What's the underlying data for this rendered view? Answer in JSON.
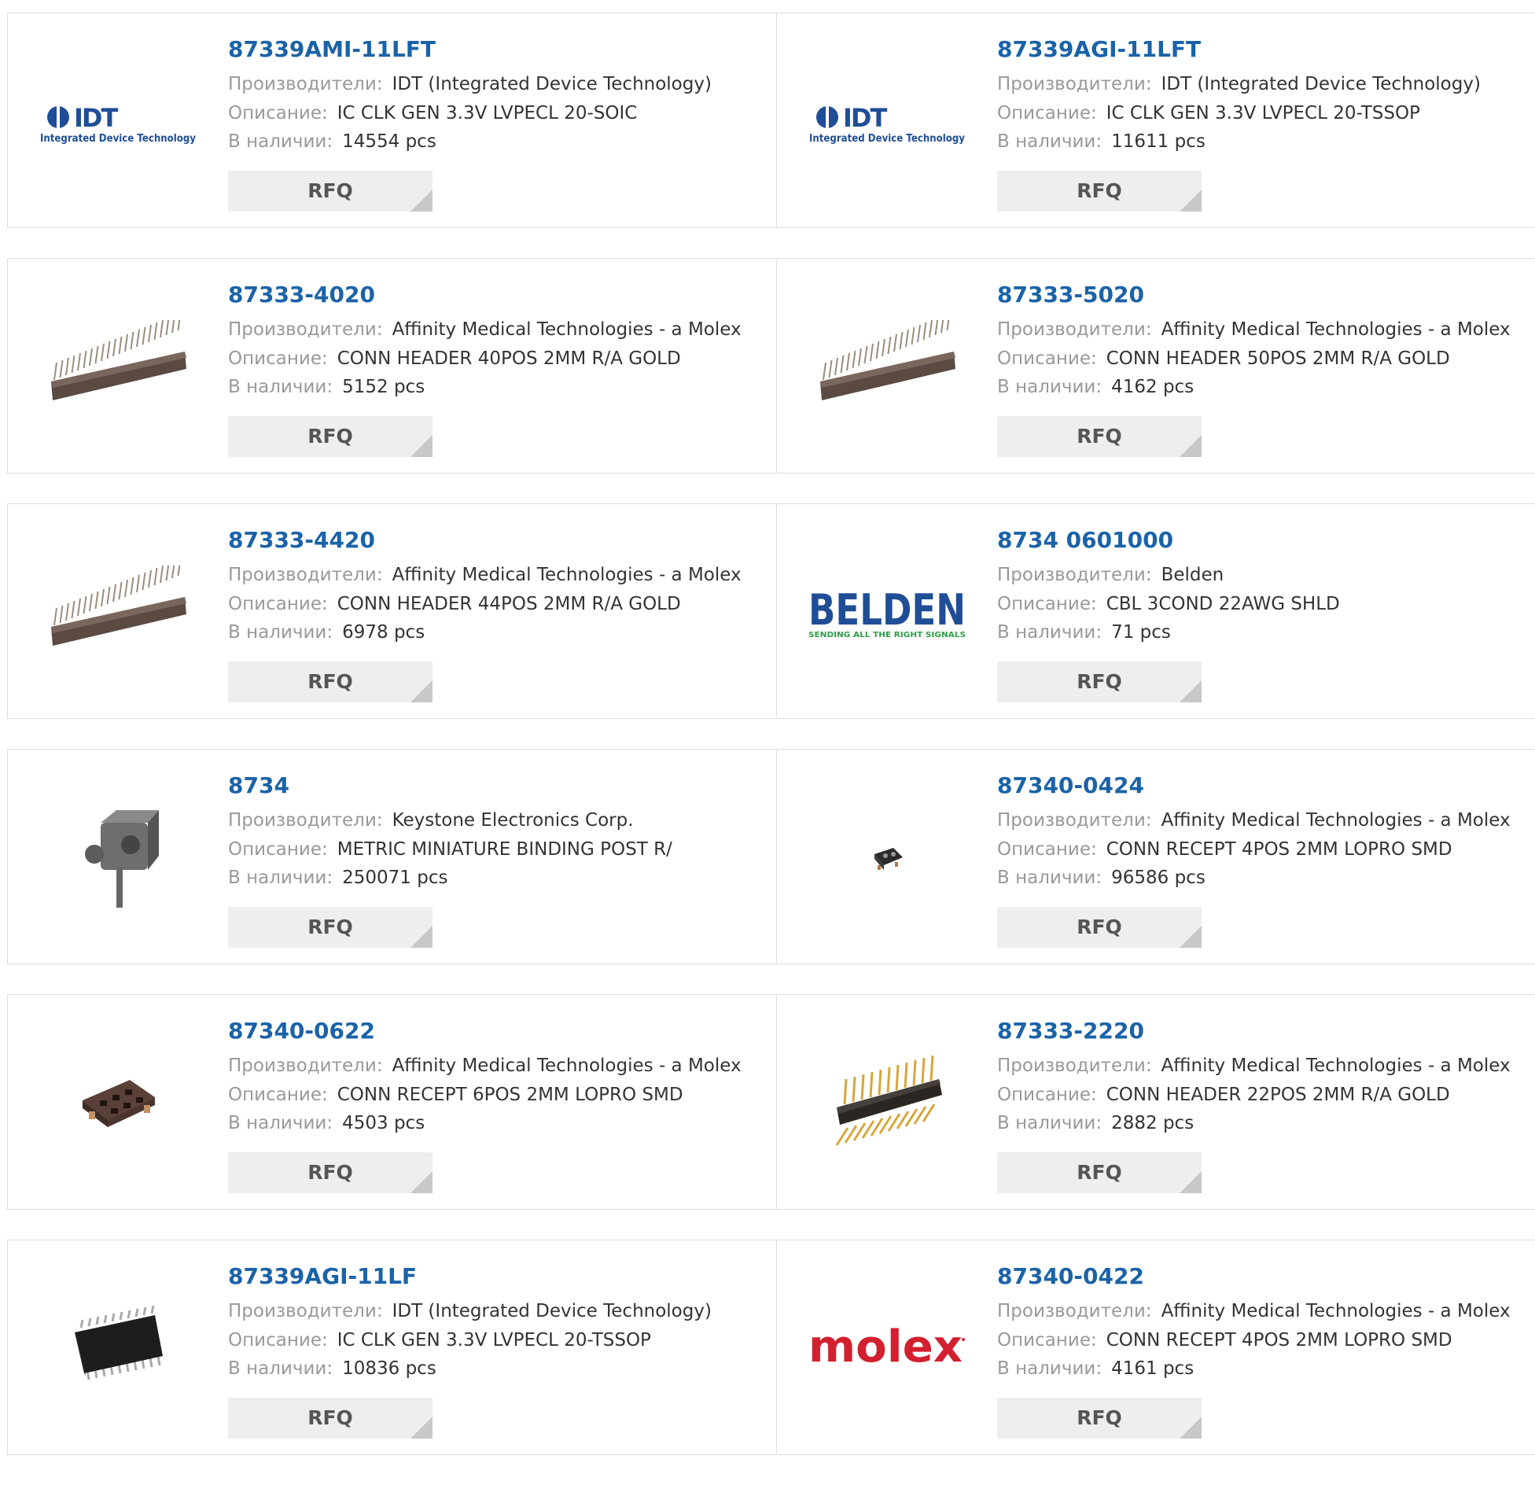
{
  "labels": {
    "manufacturer": "Производители:",
    "description": "Описание:",
    "stock": "В наличии:",
    "rfq": "RFQ"
  },
  "products": [
    {
      "pn": "87339AMI-11LFT",
      "manufacturer": "IDT (Integrated Device Technology)",
      "description": "IC CLK GEN 3.3V LVPECL 20-SOIC",
      "stock": "14554 pcs",
      "image": "idt-logo"
    },
    {
      "pn": "87339AGI-11LFT",
      "manufacturer": "IDT (Integrated Device Technology)",
      "description": "IC CLK GEN 3.3V LVPECL 20-TSSOP",
      "stock": "11611 pcs",
      "image": "idt-logo"
    },
    {
      "pn": "87333-4020",
      "manufacturer": "Affinity Medical Technologies - a Molex",
      "description": "CONN HEADER 40POS 2MM R/A GOLD",
      "stock": "5152 pcs",
      "image": "header-connector"
    },
    {
      "pn": "87333-5020",
      "manufacturer": "Affinity Medical Technologies - a Molex",
      "description": "CONN HEADER 50POS 2MM R/A GOLD",
      "stock": "4162 pcs",
      "image": "header-connector"
    },
    {
      "pn": "87333-4420",
      "manufacturer": "Affinity Medical Technologies - a Molex",
      "description": "CONN HEADER 44POS 2MM R/A GOLD",
      "stock": "6978 pcs",
      "image": "header-connector"
    },
    {
      "pn": "8734 0601000",
      "manufacturer": "Belden",
      "description": "CBL 3COND 22AWG SHLD",
      "stock": "71 pcs",
      "image": "belden-logo"
    },
    {
      "pn": "8734",
      "manufacturer": "Keystone Electronics Corp.",
      "description": "METRIC MINIATURE BINDING POST R/",
      "stock": "250071 pcs",
      "image": "binding-post"
    },
    {
      "pn": "87340-0424",
      "manufacturer": "Affinity Medical Technologies - a Molex",
      "description": "CONN RECEPT 4POS 2MM LOPRO SMD",
      "stock": "96586 pcs",
      "image": "small-receptacle"
    },
    {
      "pn": "87340-0622",
      "manufacturer": "Affinity Medical Technologies - a Molex",
      "description": "CONN RECEPT 6POS 2MM LOPRO SMD",
      "stock": "4503 pcs",
      "image": "receptacle-6pos"
    },
    {
      "pn": "87333-2220",
      "manufacturer": "Affinity Medical Technologies - a Molex",
      "description": "CONN HEADER 22POS 2MM R/A GOLD",
      "stock": "2882 pcs",
      "image": "gold-header"
    },
    {
      "pn": "87339AGI-11LF",
      "manufacturer": "IDT (Integrated Device Technology)",
      "description": "IC CLK GEN 3.3V LVPECL 20-TSSOP",
      "stock": "10836 pcs",
      "image": "tssop-chip"
    },
    {
      "pn": "87340-0422",
      "manufacturer": "Affinity Medical Technologies - a Molex",
      "description": "CONN RECEPT 4POS 2MM LOPRO SMD",
      "stock": "4161 pcs",
      "image": "molex-logo"
    }
  ],
  "logos": {
    "idt": {
      "mark": "IDT",
      "tagline": "Integrated Device Technology",
      "color": "#1f4e97"
    },
    "belden": {
      "mark": "BELDEN",
      "tagline": "SENDING ALL THE RIGHT SIGNALS",
      "color": "#1f4e97",
      "tagline_color": "#2e9e49"
    },
    "molex": {
      "mark": "molex",
      "color": "#d3202f"
    }
  },
  "colors": {
    "link": "#1a63a8",
    "label": "#999999",
    "value": "#333333",
    "button_bg": "#eeeeee",
    "border": "#dddddd"
  }
}
